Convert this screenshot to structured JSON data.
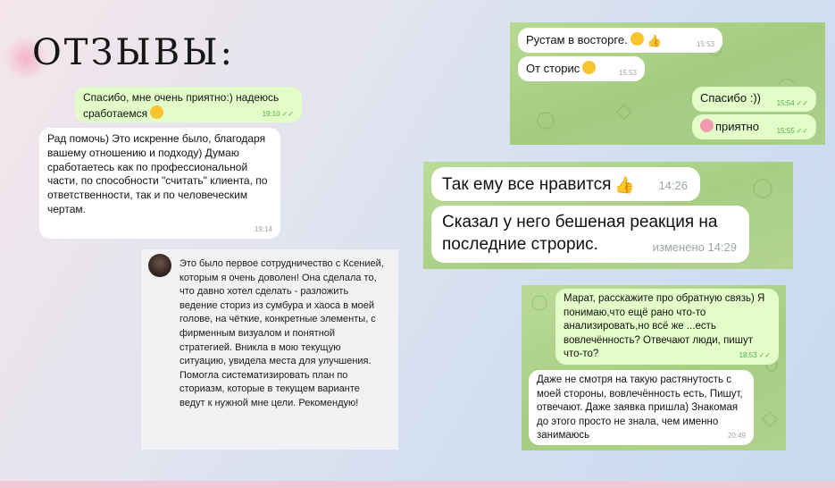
{
  "page": {
    "title": "ОТЗЫВЫ:"
  },
  "chat1": {
    "msg1": {
      "text": "Спасибо, мне очень приятно:) надеюсь сработаемся",
      "emoji": "relieved-face",
      "time": "19:10"
    },
    "msg2": {
      "text": "Рад помочь) Это искренне было, благодаря вашему отношению и подходу) Думаю сработаетесь как по профессиональной части, по способности \"считать\" клиента, по ответственности, так и по человеческим чертам.",
      "time": "19:14"
    }
  },
  "review": {
    "text": "Это было первое сотрудничество с Ксенией, которым я очень доволен! Она сделала то, что давно хотел сделать - разложить ведение сториз из сумбура и хаоса в моей голове, на чёткие, конкретные элементы, с фирменным визуалом и понятной стратегией. Вникла в мою текущую ситуацию, увидела места для улучшения. Помогла систематизировать план по сториазм, которые в текущем варианте ведут к нужной мне цели. Рекомендую!"
  },
  "chat2": {
    "msg1": {
      "text": "Рустам в восторге.",
      "emoji": "kissing-face",
      "emoji2": "thumbs-up",
      "time": "15:53"
    },
    "msg2": {
      "text": "От сторис",
      "emoji": "smiling-face",
      "time": "15:53"
    },
    "msg3": {
      "text": "Спасибо :))",
      "time": "15:54"
    },
    "msg4": {
      "text": "приятно",
      "emoji": "smiling-hearts-face",
      "time": "15:55"
    }
  },
  "chat3": {
    "msg1": {
      "text": "Так ему все нравится",
      "emoji": "thumbs-up",
      "time": "14:26"
    },
    "msg2": {
      "text": "Сказал у него бешеная реакция на последние строрис.",
      "time": "изменено 14:29"
    }
  },
  "chat4": {
    "msg1": {
      "text": "Марат, расскажите про обратную связь) Я понимаю,что ещё рано что-то анализировать,но всё же ...есть вовлечённость? Отвечают люди, пишут что-то?",
      "time": "18:53"
    },
    "msg2": {
      "text": "Даже не смотря на такую растянутость с моей стороны, вовлечённость есть, Пишут, отвечают. Даже заявка пришла) Знакомая до этого просто не знала, чем именно занимаюсь",
      "time": "20:49"
    }
  },
  "colors": {
    "chat_green": "#a9cf86",
    "outgoing_bubble": "#e3fdc8",
    "incoming_bubble": "#ffffff",
    "tick_green": "#4fae4e"
  }
}
